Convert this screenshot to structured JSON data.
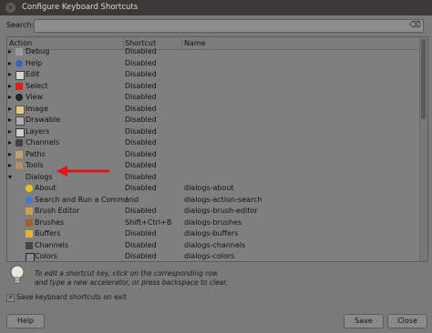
{
  "window": {
    "title": "Configure Keyboard Shortcuts"
  },
  "search": {
    "label": "Search:",
    "value": ""
  },
  "columns": {
    "action": "Action",
    "shortcut": "Shortcut",
    "name": "Name"
  },
  "rows": [
    {
      "action": "Debug",
      "shortcut": "Disabled",
      "name": "",
      "icon": "debug-icon",
      "expander": "▸"
    },
    {
      "action": "Help",
      "shortcut": "Disabled",
      "name": "",
      "icon": "help-icon",
      "expander": "▸"
    },
    {
      "action": "Edit",
      "shortcut": "Disabled",
      "name": "",
      "icon": "edit-icon",
      "expander": "▸"
    },
    {
      "action": "Select",
      "shortcut": "Disabled",
      "name": "",
      "icon": "select-icon",
      "expander": "▸"
    },
    {
      "action": "View",
      "shortcut": "Disabled",
      "name": "",
      "icon": "view-icon",
      "expander": "▸"
    },
    {
      "action": "Image",
      "shortcut": "Disabled",
      "name": "",
      "icon": "image-icon",
      "expander": "▸"
    },
    {
      "action": "Drawable",
      "shortcut": "Disabled",
      "name": "",
      "icon": "drawable-icon",
      "expander": "▸"
    },
    {
      "action": "Layers",
      "shortcut": "Disabled",
      "name": "",
      "icon": "layers-icon",
      "expander": "▸"
    },
    {
      "action": "Channels",
      "shortcut": "Disabled",
      "name": "",
      "icon": "channels-icon",
      "expander": "▸"
    },
    {
      "action": "Paths",
      "shortcut": "Disabled",
      "name": "",
      "icon": "paths-icon",
      "expander": "▸"
    },
    {
      "action": "Tools",
      "shortcut": "Disabled",
      "name": "",
      "icon": "tools-icon",
      "expander": "▸"
    },
    {
      "action": "Dialogs",
      "shortcut": "Disabled",
      "name": "",
      "icon": "",
      "expander": "▾"
    },
    {
      "action": "About",
      "shortcut": "Disabled",
      "name": "dialogs-about",
      "icon": "about-icon",
      "expander": ""
    },
    {
      "action": "Search and Run a Command",
      "shortcut": "/",
      "name": "dialogs-action-search",
      "icon": "search-run-icon",
      "expander": ""
    },
    {
      "action": "Brush Editor",
      "shortcut": "Disabled",
      "name": "dialogs-brush-editor",
      "icon": "brush-editor-icon",
      "expander": ""
    },
    {
      "action": "Brushes",
      "shortcut": "Shift+Ctrl+B",
      "name": "dialogs-brushes",
      "icon": "brushes-icon",
      "expander": ""
    },
    {
      "action": "Buffers",
      "shortcut": "Disabled",
      "name": "dialogs-buffers",
      "icon": "buffers-icon",
      "expander": ""
    },
    {
      "action": "Channels",
      "shortcut": "Disabled",
      "name": "dialogs-channels",
      "icon": "channels-icon",
      "expander": ""
    },
    {
      "action": "Colors",
      "shortcut": "Disabled",
      "name": "dialogs-colors",
      "icon": "colors-icon",
      "expander": ""
    }
  ],
  "hint": {
    "line1": "To edit a shortcut key, click on the corresponding row",
    "line2": "and type a new accelerator, or press backspace to clear."
  },
  "save_on_exit": {
    "label": "Save keyboard shortcuts on exit",
    "checked": true
  },
  "buttons": {
    "help": "Help",
    "save": "Save",
    "close": "Close"
  },
  "colors": {
    "annotation_arrow": "#e0141a",
    "background": "#7a7a7a"
  }
}
